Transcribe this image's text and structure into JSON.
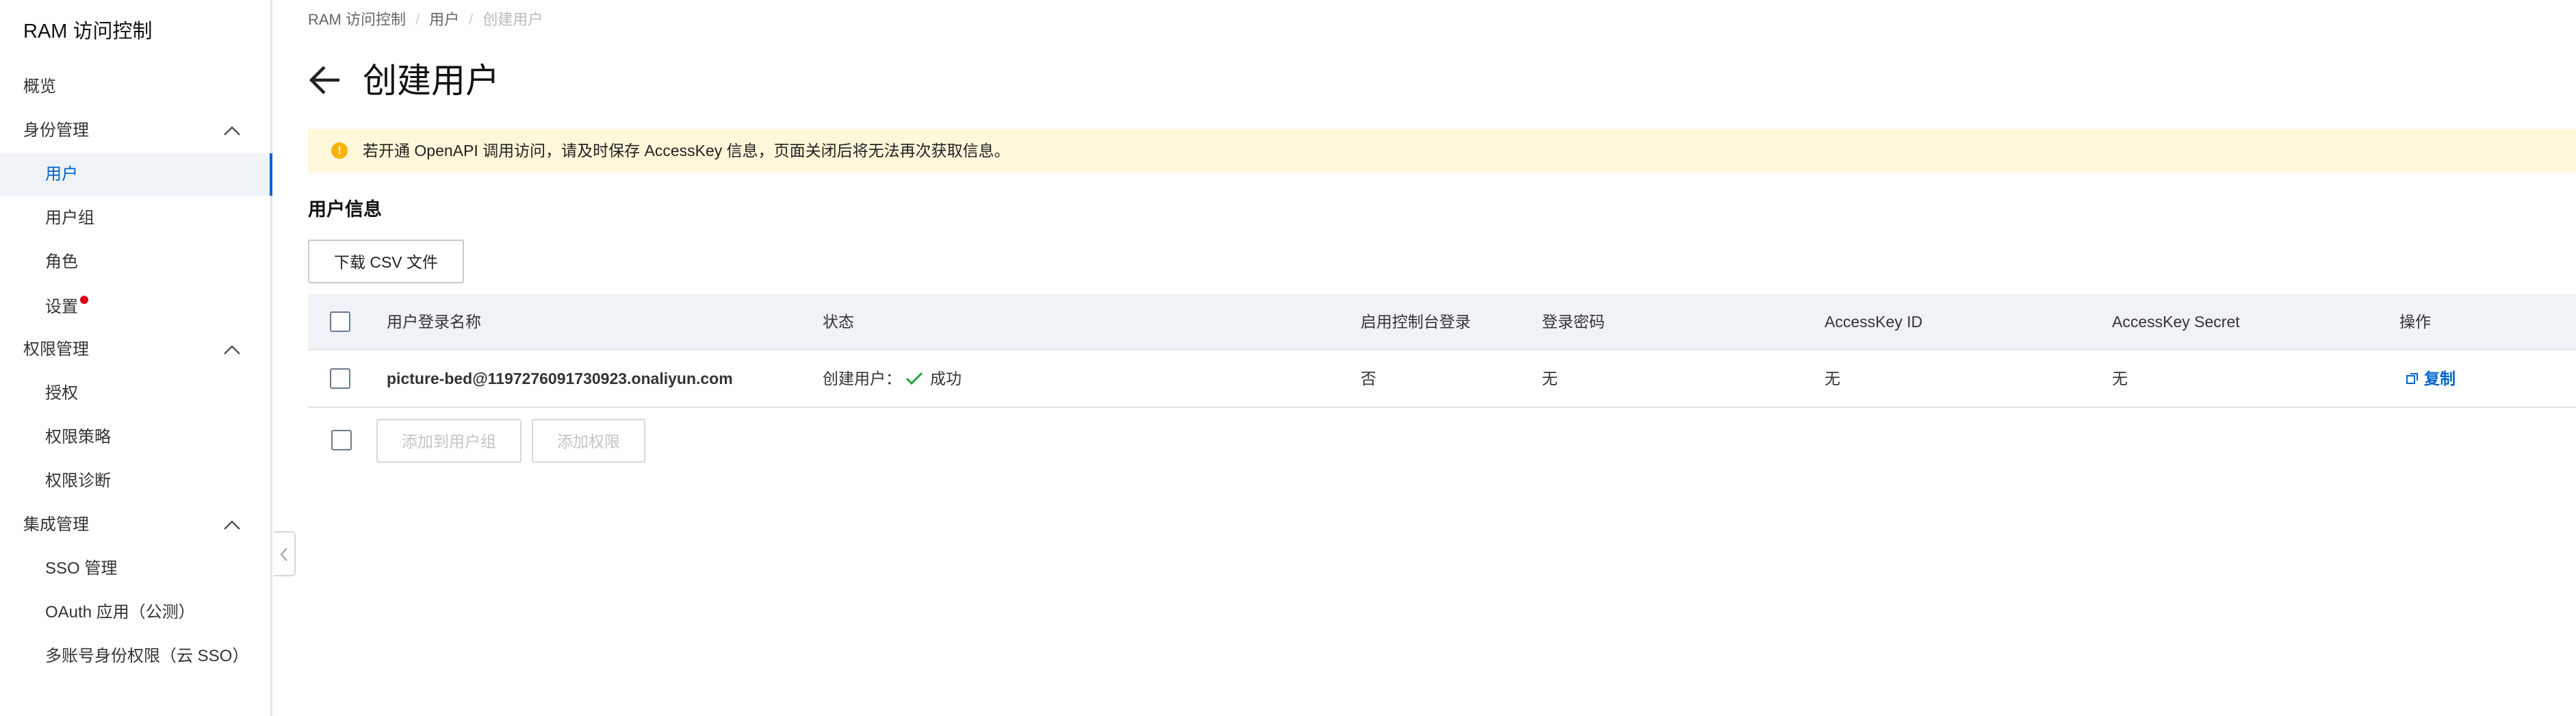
{
  "sidebar": {
    "title": "RAM 访问控制",
    "items": [
      {
        "label": "概览"
      },
      {
        "label": "身份管理"
      },
      {
        "label": "用户"
      },
      {
        "label": "用户组"
      },
      {
        "label": "角色"
      },
      {
        "label": "设置"
      },
      {
        "label": "权限管理"
      },
      {
        "label": "授权"
      },
      {
        "label": "权限策略"
      },
      {
        "label": "权限诊断"
      },
      {
        "label": "集成管理"
      },
      {
        "label": "SSO 管理"
      },
      {
        "label": "OAuth 应用（公测）"
      },
      {
        "label": "多账号身份权限（云 SSO）"
      }
    ]
  },
  "breadcrumb": [
    "RAM 访问控制",
    "用户",
    "创建用户"
  ],
  "page": {
    "title": "创建用户",
    "alert": "若开通 OpenAPI 调用访问，请及时保存 AccessKey 信息，页面关闭后将无法再次获取信息。",
    "section_title": "用户信息",
    "download_button": "下载 CSV 文件"
  },
  "table": {
    "columns": [
      "用户登录名称",
      "状态",
      "启用控制台登录",
      "登录密码",
      "AccessKey ID",
      "AccessKey Secret",
      "操作"
    ],
    "rows": [
      {
        "login_name": "picture-bed@1197276091730923.onaliyun.com",
        "status_prefix": "创建用户：",
        "status": "成功",
        "console_login": "否",
        "password": "无",
        "access_key_id": "无",
        "access_key_secret": "无",
        "action": "复制"
      }
    ]
  },
  "footer_actions": {
    "add_to_group": "添加到用户组",
    "add_permission": "添加权限"
  },
  "colors": {
    "accent": "#0064c8",
    "success": "#1fa33a",
    "warning": "#f5b400",
    "alert_bg": "#fff7d9",
    "active_bg": "#eff3f8",
    "badge": "#d9001b"
  }
}
